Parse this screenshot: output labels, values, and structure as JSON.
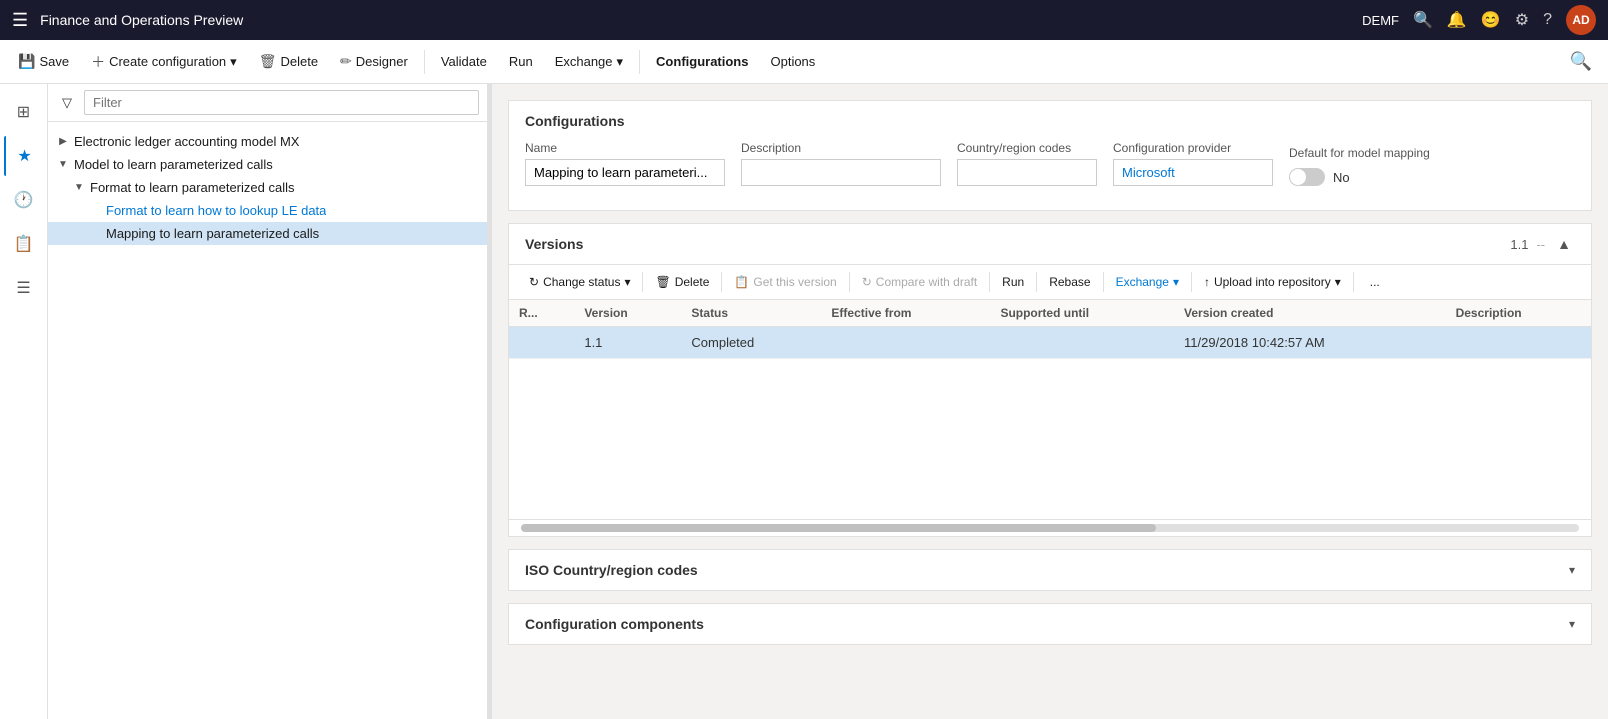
{
  "titleBar": {
    "appName": "Finance and Operations Preview",
    "userLabel": "DEMF",
    "avatarText": "AD"
  },
  "commandBar": {
    "saveLabel": "Save",
    "createConfigLabel": "Create configuration",
    "deleteLabel": "Delete",
    "designerLabel": "Designer",
    "validateLabel": "Validate",
    "runLabel": "Run",
    "exchangeLabel": "Exchange",
    "configurationsLabel": "Configurations",
    "optionsLabel": "Options"
  },
  "filterPlaceholder": "Filter",
  "tree": {
    "items": [
      {
        "id": "item1",
        "label": "Electronic ledger accounting model MX",
        "level": 0,
        "toggle": "▶",
        "isLink": false
      },
      {
        "id": "item2",
        "label": "Model to learn parameterized calls",
        "level": 0,
        "toggle": "▼",
        "isLink": false
      },
      {
        "id": "item3",
        "label": "Format to learn parameterized calls",
        "level": 1,
        "toggle": "▼",
        "isLink": false
      },
      {
        "id": "item4",
        "label": "Format to learn how to lookup LE data",
        "level": 2,
        "toggle": "",
        "isLink": true
      },
      {
        "id": "item5",
        "label": "Mapping to learn parameterized calls",
        "level": 2,
        "toggle": "",
        "isLink": false,
        "selected": true
      }
    ]
  },
  "detailPanel": {
    "configurationsTitle": "Configurations",
    "nameLabel": "Name",
    "nameValue": "Mapping to learn parameteri...",
    "descriptionLabel": "Description",
    "descriptionValue": "",
    "countryLabel": "Country/region codes",
    "countryValue": "",
    "providerLabel": "Configuration provider",
    "providerValue": "Microsoft",
    "defaultMappingLabel": "Default for model mapping",
    "defaultMappingToggleLabel": "No",
    "versionsTitle": "Versions",
    "versionsNumber": "1.1",
    "versionsDash": "--",
    "versionsToolbar": {
      "changeStatusLabel": "Change status",
      "deleteLabel": "Delete",
      "getVersionLabel": "Get this version",
      "compareLabel": "Compare with draft",
      "runLabel": "Run",
      "rebaseLabel": "Rebase",
      "exchangeLabel": "Exchange",
      "uploadLabel": "Upload into repository",
      "moreLabel": "..."
    },
    "versionsTable": {
      "columns": [
        "R...",
        "Version",
        "Status",
        "Effective from",
        "Supported until",
        "Version created",
        "Description"
      ],
      "rows": [
        {
          "r": "",
          "version": "1.1",
          "status": "Completed",
          "effectiveFrom": "",
          "supportedUntil": "",
          "versionCreated": "11/29/2018 10:42:57 AM",
          "description": "",
          "selected": true
        }
      ]
    },
    "isoSectionTitle": "ISO Country/region codes",
    "configComponentsTitle": "Configuration components"
  }
}
